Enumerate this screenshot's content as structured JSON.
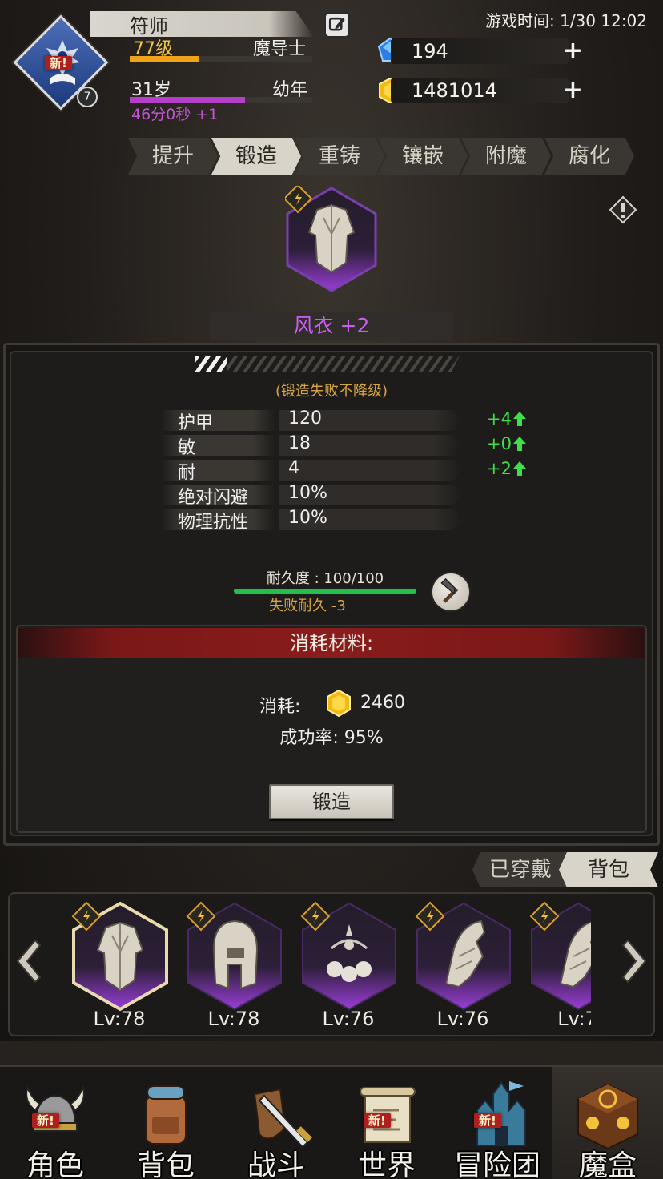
{
  "player": {
    "name": "符师",
    "level": "77级",
    "class": "魔导士",
    "exp_fraction": 0.38,
    "age": "31岁",
    "life_stage": "幼年",
    "age_fraction": 0.63,
    "age_timer": "46分0秒 +1",
    "avatar_badge": "7",
    "avatar_new": "新!"
  },
  "game_time": "游戏时间: 1/30 12:02",
  "currency": {
    "gems": "194",
    "gold": "1481014",
    "plus": "+"
  },
  "tabs": [
    "提升",
    "锻造",
    "重铸",
    "镶嵌",
    "附魔",
    "腐化"
  ],
  "active_tab": 1,
  "featured_item": {
    "name": "风衣 +2",
    "icon": "coat-icon"
  },
  "forge": {
    "progress_fraction": 0.12,
    "no_downgrade_note": "(锻造失败不降级)",
    "stats": [
      {
        "name": "护甲",
        "value": "120",
        "delta": "+4"
      },
      {
        "name": "敏",
        "value": "18",
        "delta": "+0"
      },
      {
        "name": "耐",
        "value": "4",
        "delta": "+2"
      },
      {
        "name": "绝对闪避",
        "value": "10%",
        "delta": ""
      },
      {
        "name": "物理抗性",
        "value": "10%",
        "delta": ""
      }
    ],
    "durability_label": "耐久度 : 100/100",
    "durability_fraction": 1.0,
    "fail_durability": "失败耐久 -3",
    "materials_header": "消耗材料:",
    "cost_label": "消耗:",
    "cost_value": "2460",
    "success_rate": "成功率: 95%",
    "forge_button": "锻造"
  },
  "inventory": {
    "toggle_equipped": "已穿戴",
    "toggle_bag": "背包",
    "items": [
      {
        "icon": "coat-icon",
        "level": "Lv:78",
        "selected": true
      },
      {
        "icon": "helmet-icon",
        "level": "Lv:78",
        "selected": false
      },
      {
        "icon": "necklace-icon",
        "level": "Lv:76",
        "selected": false
      },
      {
        "icon": "gauntlet-icon",
        "level": "Lv:76",
        "selected": false
      },
      {
        "icon": "gauntlet-icon",
        "level": "Lv:7",
        "selected": false
      }
    ]
  },
  "bottom_nav": [
    {
      "label": "角色",
      "icon": "viking-helmet-icon",
      "new": "新!"
    },
    {
      "label": "背包",
      "icon": "backpack-icon",
      "new": ""
    },
    {
      "label": "战斗",
      "icon": "sword-shield-icon",
      "new": ""
    },
    {
      "label": "世界",
      "icon": "scroll-map-icon",
      "new": "新!"
    },
    {
      "label": "冒险团",
      "icon": "castle-icon",
      "new": "新!"
    },
    {
      "label": "魔盒",
      "icon": "magic-box-icon",
      "new": ""
    }
  ],
  "colors": {
    "accent_gold": "#f5c842",
    "rarity_purple": "#c95ef0",
    "stat_up_green": "#3ee04a",
    "warning_orange": "#d8a640",
    "header_red": "#8a1c1c"
  }
}
